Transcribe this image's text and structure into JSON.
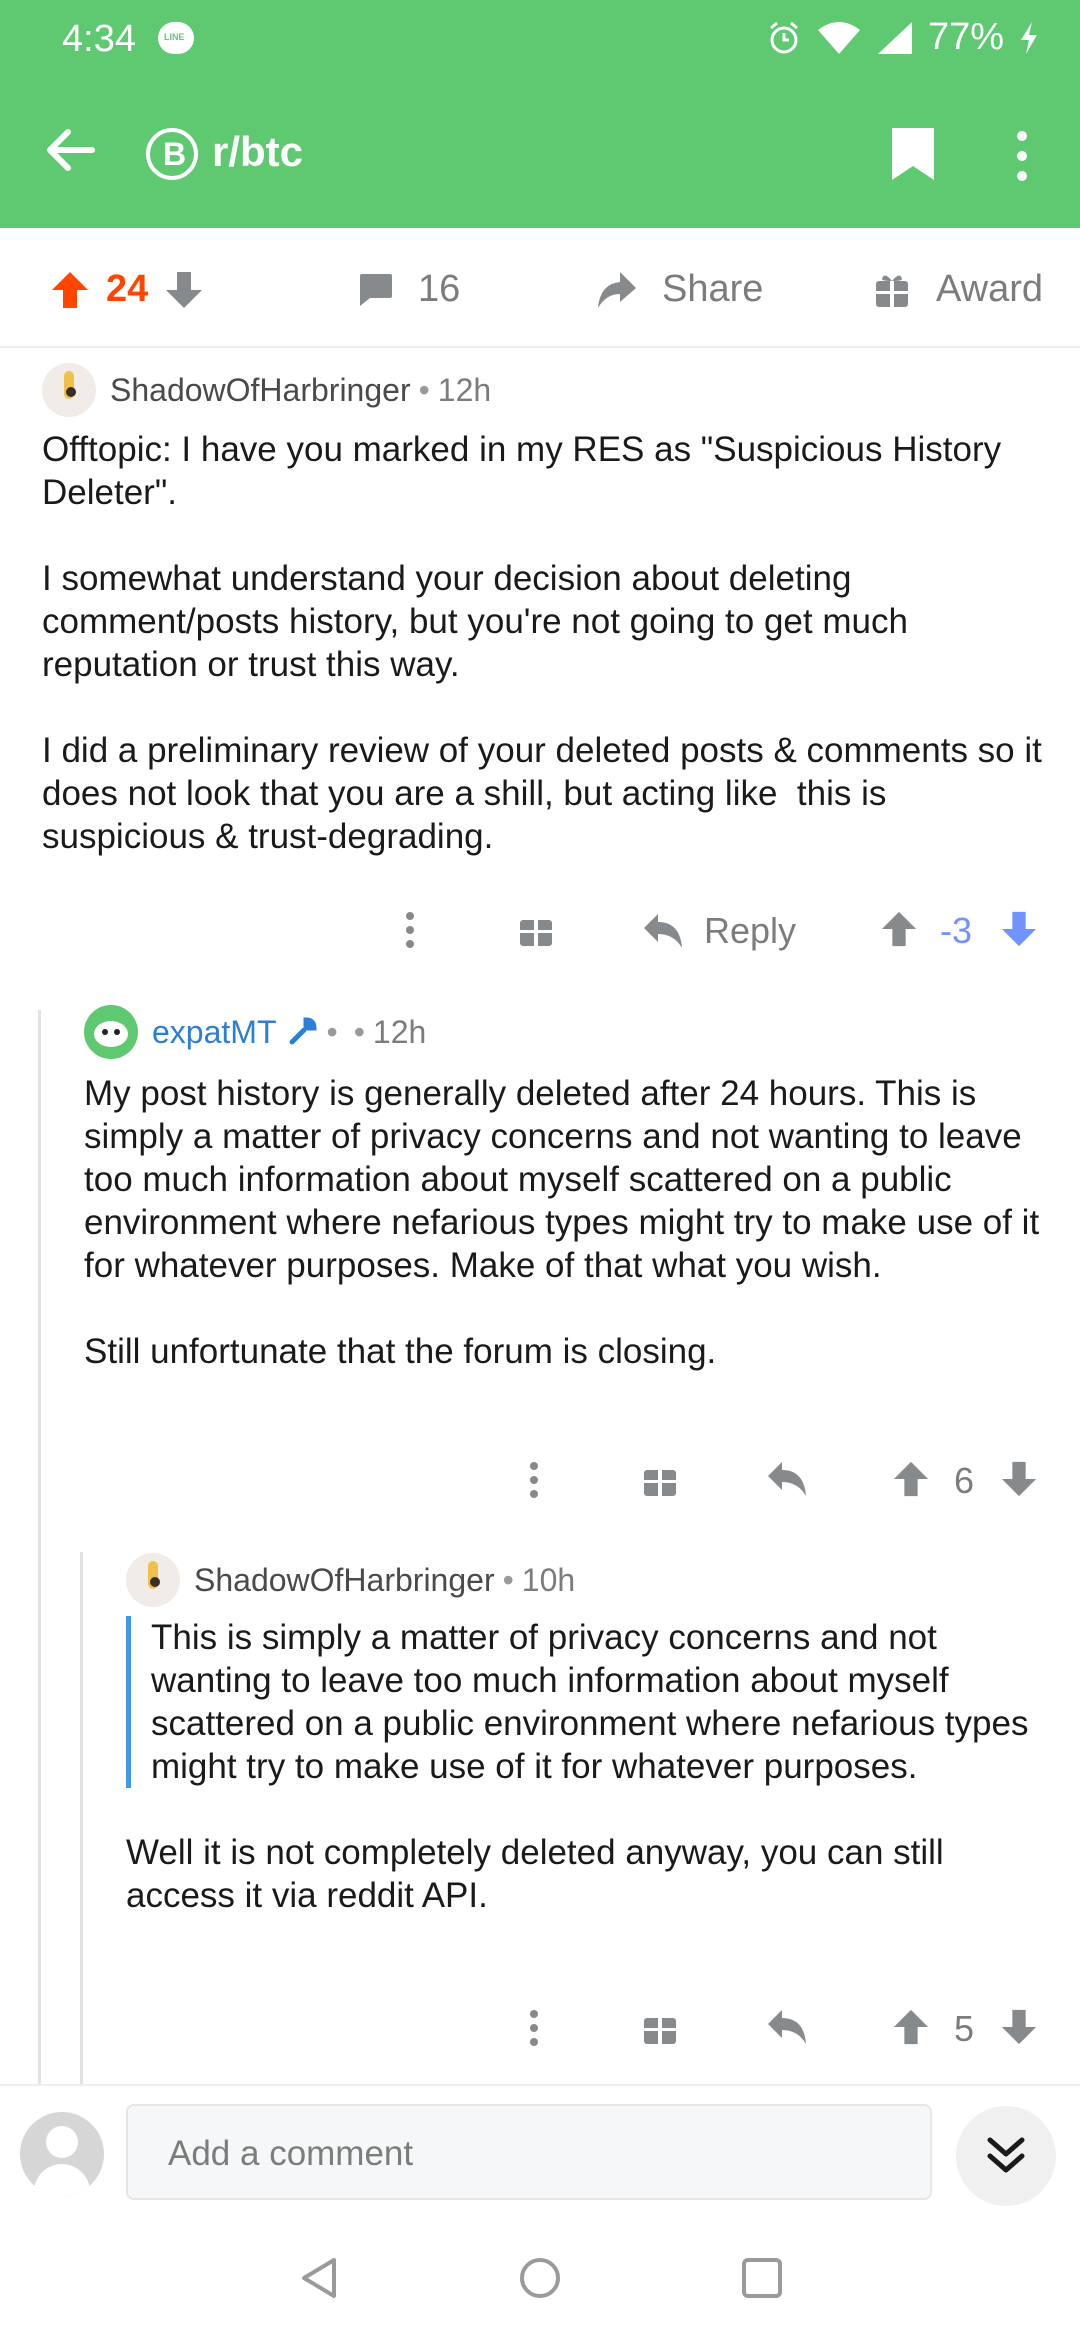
{
  "status_bar": {
    "time": "4:34",
    "battery": "77%"
  },
  "app_bar": {
    "subreddit": "r/btc",
    "sub_icon_letter": "B"
  },
  "post_actions": {
    "score": "24",
    "comments": "16",
    "share": "Share",
    "award": "Award"
  },
  "comments": [
    {
      "author": "ShadowOfHarbringer",
      "age": "12h",
      "paragraphs": [
        "Offtopic: I have you marked in my RES as \"Suspicious History Deleter\".",
        "I somewhat understand your decision about deleting comment/posts history, but you're not going to get much reputation or trust this way.",
        "I did a preliminary review of your deleted posts & comments so it does not look that you are a shill, but acting like  this is suspicious & trust-degrading."
      ],
      "reply_label": "Reply",
      "score": "-3"
    },
    {
      "author": "expatMT",
      "age": "12h",
      "paragraphs": [
        "My post history is generally deleted after 24 hours. This is simply a matter of privacy concerns and not wanting to leave too much information about myself scattered on a public environment where nefarious types might try to make use of it for whatever purposes. Make of that what you wish.",
        "Still unfortunate that the forum is closing."
      ],
      "score": "6"
    },
    {
      "author": "ShadowOfHarbringer",
      "age": "10h",
      "quote": "This is simply a matter of privacy concerns and not wanting to leave too much information about myself scattered on a public environment where nefarious types might try to make use of it for whatever purposes.",
      "paragraphs": [
        "Well it is not completely deleted anyway, you can still access it via reddit API."
      ],
      "score": "5"
    }
  ],
  "comment_bar": {
    "placeholder": "Add a comment"
  },
  "colors": {
    "header_green": "#5fc972",
    "upvote_orange": "#ff4500",
    "downvote_blue": "#7193ff",
    "mod_blue": "#2c7fd6"
  }
}
